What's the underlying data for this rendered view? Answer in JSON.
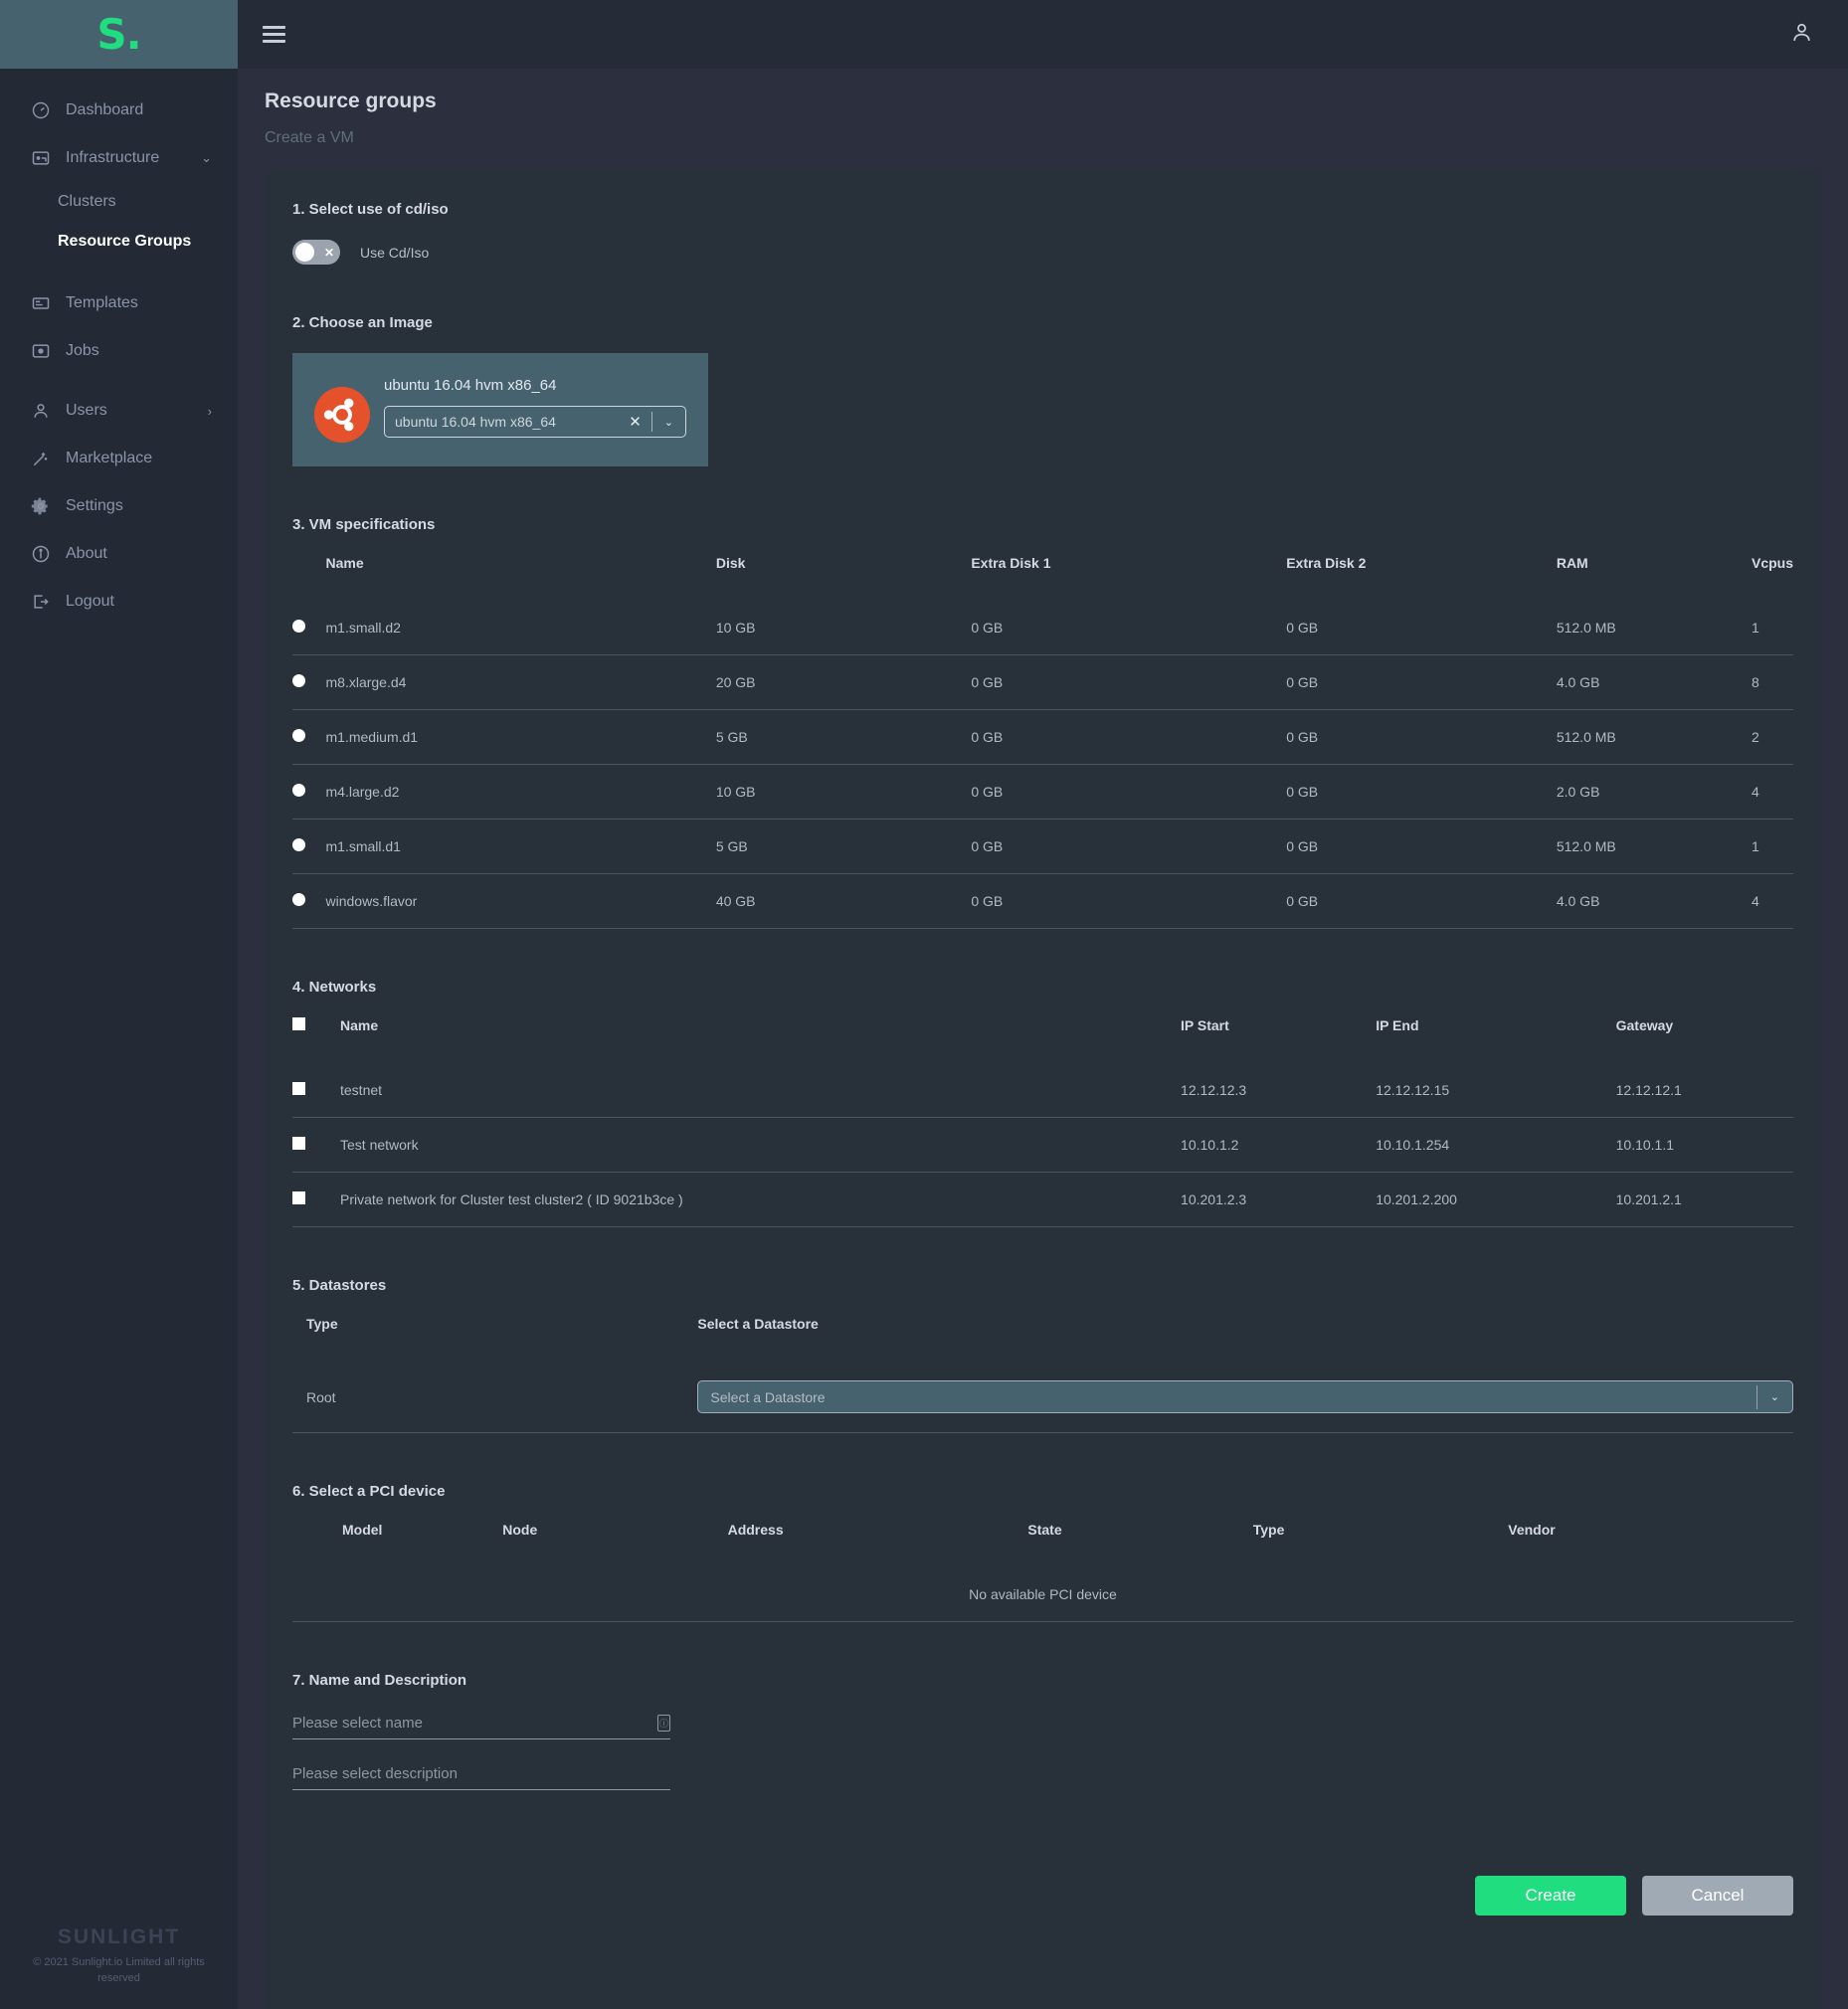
{
  "sidebar": {
    "logo_text": "S.",
    "items": [
      {
        "label": "Dashboard",
        "icon": "gauge-icon",
        "has_chevron": false
      },
      {
        "label": "Infrastructure",
        "icon": "server-icon",
        "has_chevron": true,
        "chevron": "⌄"
      },
      {
        "label": "Templates",
        "icon": "template-icon",
        "has_chevron": false
      },
      {
        "label": "Jobs",
        "icon": "jobs-icon",
        "has_chevron": false
      },
      {
        "label": "Users",
        "icon": "user-icon",
        "has_chevron": true,
        "chevron": "›"
      },
      {
        "label": "Marketplace",
        "icon": "wand-icon",
        "has_chevron": false
      },
      {
        "label": "Settings",
        "icon": "gear-icon",
        "has_chevron": false
      },
      {
        "label": "About",
        "icon": "info-icon",
        "has_chevron": false
      },
      {
        "label": "Logout",
        "icon": "logout-icon",
        "has_chevron": false
      }
    ],
    "sub_items": [
      {
        "label": "Clusters",
        "active": false
      },
      {
        "label": "Resource Groups",
        "active": true
      }
    ],
    "footer_logo": "SUNLIGHT",
    "copyright": "© 2021 Sunlight.io Limited all rights reserved"
  },
  "topbar": {
    "menu_icon": "hamburger-icon",
    "account_icon": "account-icon"
  },
  "header": {
    "title": "Resource groups",
    "breadcrumb": "Create a VM"
  },
  "step1": {
    "title": "1. Select use of cd/iso",
    "toggle_label": "Use Cd/Iso",
    "toggle_state": "off",
    "toggle_mark": "✕"
  },
  "step2": {
    "title": "2. Choose an Image",
    "image_name": "ubuntu 16.04 hvm x86_64",
    "select_value": "ubuntu 16.04 hvm x86_64",
    "clear_icon": "✕",
    "caret_icon": "⌄",
    "logo_icon": "ubuntu-logo-icon"
  },
  "step3": {
    "title": "3. VM specifications",
    "columns": [
      "",
      "Name",
      "Disk",
      "Extra Disk 1",
      "Extra Disk 2",
      "RAM",
      "Vcpus"
    ],
    "rows": [
      {
        "name": "m1.small.d2",
        "disk": "10 GB",
        "extra1": "0 GB",
        "extra2": "0 GB",
        "ram": "512.0 MB",
        "vcpus": "1"
      },
      {
        "name": "m8.xlarge.d4",
        "disk": "20 GB",
        "extra1": "0 GB",
        "extra2": "0 GB",
        "ram": "4.0 GB",
        "vcpus": "8"
      },
      {
        "name": "m1.medium.d1",
        "disk": "5 GB",
        "extra1": "0 GB",
        "extra2": "0 GB",
        "ram": "512.0 MB",
        "vcpus": "2"
      },
      {
        "name": "m4.large.d2",
        "disk": "10 GB",
        "extra1": "0 GB",
        "extra2": "0 GB",
        "ram": "2.0 GB",
        "vcpus": "4"
      },
      {
        "name": "m1.small.d1",
        "disk": "5 GB",
        "extra1": "0 GB",
        "extra2": "0 GB",
        "ram": "512.0 MB",
        "vcpus": "1"
      },
      {
        "name": "windows.flavor",
        "disk": "40 GB",
        "extra1": "0 GB",
        "extra2": "0 GB",
        "ram": "4.0 GB",
        "vcpus": "4"
      }
    ]
  },
  "step4": {
    "title": "4. Networks",
    "columns": [
      "",
      "Name",
      "IP Start",
      "IP End",
      "Gateway"
    ],
    "rows": [
      {
        "name": "testnet",
        "ip_start": "12.12.12.3",
        "ip_end": "12.12.12.15",
        "gateway": "12.12.12.1"
      },
      {
        "name": "Test network",
        "ip_start": "10.10.1.2",
        "ip_end": "10.10.1.254",
        "gateway": "10.10.1.1"
      },
      {
        "name": "Private network for Cluster test cluster2 ( ID 9021b3ce )",
        "ip_start": "10.201.2.3",
        "ip_end": "10.201.2.200",
        "gateway": "10.201.2.1"
      }
    ]
  },
  "step5": {
    "title": "5. Datastores",
    "col_type": "Type",
    "col_select": "Select a Datastore",
    "row_type": "Root",
    "placeholder": "Select a Datastore",
    "caret_icon": "⌄"
  },
  "step6": {
    "title": "6. Select a PCI device",
    "columns": [
      "Model",
      "Node",
      "Address",
      "State",
      "Type",
      "Vendor"
    ],
    "empty_text": "No available PCI device"
  },
  "step7": {
    "title": "7. Name and Description",
    "name_placeholder": "Please select name",
    "description_placeholder": "Please select description",
    "tip_icon": "info-tip-icon",
    "tip_glyph": "ⓘ"
  },
  "actions": {
    "create_label": "Create",
    "cancel_label": "Cancel"
  },
  "colors": {
    "accent_green": "#20de7f",
    "panel_bg": "#28313a",
    "card_bg": "#46626e",
    "ubuntu_orange": "#e4512a"
  }
}
